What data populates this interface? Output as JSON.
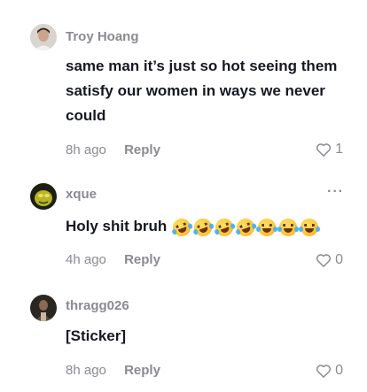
{
  "comments": [
    {
      "username": "Troy Hoang",
      "text": "same man it’s just so hot seeing them satisfy our women in ways we never could",
      "time": "8h ago",
      "reply_label": "Reply",
      "likes": "1"
    },
    {
      "username": "xque",
      "text": "Holy shit bruh",
      "emojis": [
        "rolling-on-floor-laughing",
        "rolling-on-floor-laughing",
        "rolling-on-floor-laughing",
        "rolling-on-floor-laughing",
        "tears-of-joy",
        "tears-of-joy",
        "tears-of-joy"
      ],
      "time": "4h ago",
      "reply_label": "Reply",
      "likes": "0",
      "more_label": "···"
    },
    {
      "username": "thragg026",
      "text": "[Sticker]",
      "time": "8h ago",
      "reply_label": "Reply",
      "likes": "0"
    }
  ]
}
